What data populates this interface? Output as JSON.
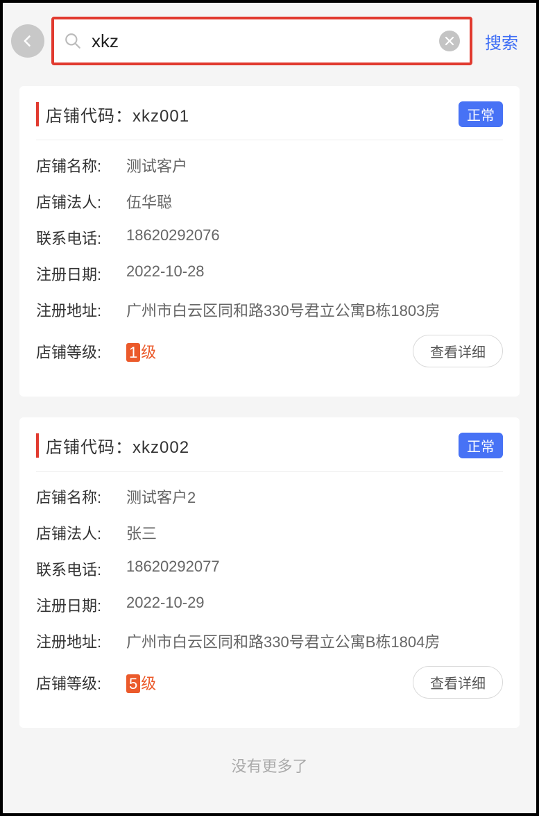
{
  "search": {
    "value": "xkz",
    "button": "搜索"
  },
  "labels": {
    "code": "店铺代码：",
    "name": "店铺名称:",
    "legal": "店铺法人:",
    "phone": "联系电话:",
    "regdate": "注册日期:",
    "address": "注册地址:",
    "level": "店铺等级:",
    "detail": "查看详细",
    "level_suffix": "级"
  },
  "footer": "没有更多了",
  "stores": [
    {
      "code": "xkz001",
      "status": "正常",
      "name": "测试客户",
      "legal": "伍华聪",
      "phone": "18620292076",
      "regdate": "2022-10-28",
      "address": "广州市白云区同和路330号君立公寓B栋1803房",
      "level": "1"
    },
    {
      "code": "xkz002",
      "status": "正常",
      "name": "测试客户2",
      "legal": "张三",
      "phone": "18620292077",
      "regdate": "2022-10-29",
      "address": "广州市白云区同和路330号君立公寓B栋1804房",
      "level": "5"
    }
  ]
}
